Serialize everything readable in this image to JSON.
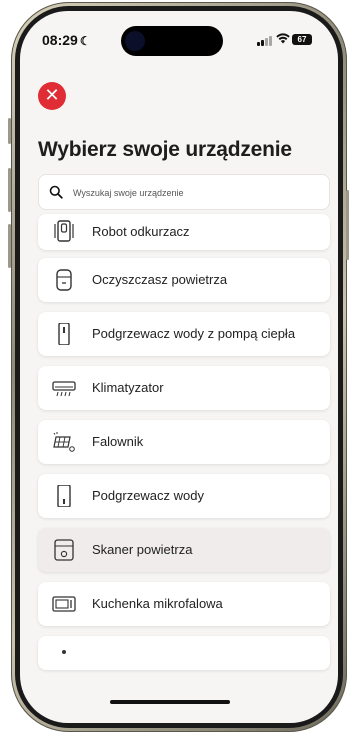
{
  "status_bar": {
    "time": "08:29",
    "focus_symbol": "☾",
    "battery_level": "67"
  },
  "header": {
    "close_symbol": "✕",
    "title": "Wybierz swoje urządzenie"
  },
  "search": {
    "placeholder": "Wyszukaj swoje urządzenie",
    "value": ""
  },
  "devices": [
    {
      "label": "Robot odkurzacz",
      "icon": "robot-vacuum-icon"
    },
    {
      "label": "Oczyszczasz powietrza",
      "icon": "air-purifier-icon"
    },
    {
      "label": "Podgrzewacz wody z pompą ciepła",
      "icon": "heat-pump-water-heater-icon"
    },
    {
      "label": "Klimatyzator",
      "icon": "air-conditioner-icon"
    },
    {
      "label": "Falownik",
      "icon": "inverter-icon"
    },
    {
      "label": "Podgrzewacz wody",
      "icon": "water-heater-icon"
    },
    {
      "label": "Skaner powietrza",
      "icon": "air-scanner-icon",
      "selected": true
    },
    {
      "label": "Kuchenka mikrofalowa",
      "icon": "microwave-icon"
    },
    {
      "label": "",
      "icon": "device-icon"
    }
  ],
  "colors": {
    "accent": "#e02d35",
    "background": "#f7f5f4",
    "card": "#ffffff",
    "card_selected": "#efeceb",
    "text": "#222222"
  }
}
